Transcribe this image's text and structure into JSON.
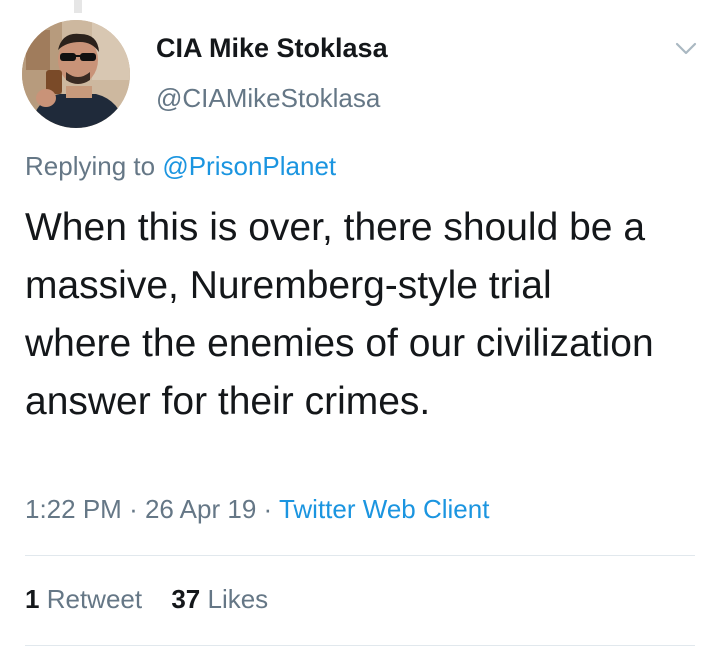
{
  "author": {
    "display_name": "CIA Mike Stoklasa",
    "handle": "@CIAMikeStoklasa",
    "avatar_icon": "profile-photo"
  },
  "menu": {
    "icon": "chevron-down-icon"
  },
  "reply": {
    "prefix": "Replying to",
    "target": "@PrisonPlanet"
  },
  "tweet": {
    "text": "When this is over, there should be a massive, Nuremberg-style trial where the enemies of our civilization answer for their crimes."
  },
  "meta": {
    "time": "1:22 PM",
    "separator": "·",
    "date": "26 Apr 19",
    "source": "Twitter Web Client"
  },
  "stats": {
    "retweets": {
      "count": "1",
      "label": "Retweet"
    },
    "likes": {
      "count": "37",
      "label": "Likes"
    }
  },
  "colors": {
    "text": "#14171a",
    "secondary": "#657786",
    "link": "#1b95e0",
    "divider": "#e1e8ed"
  }
}
